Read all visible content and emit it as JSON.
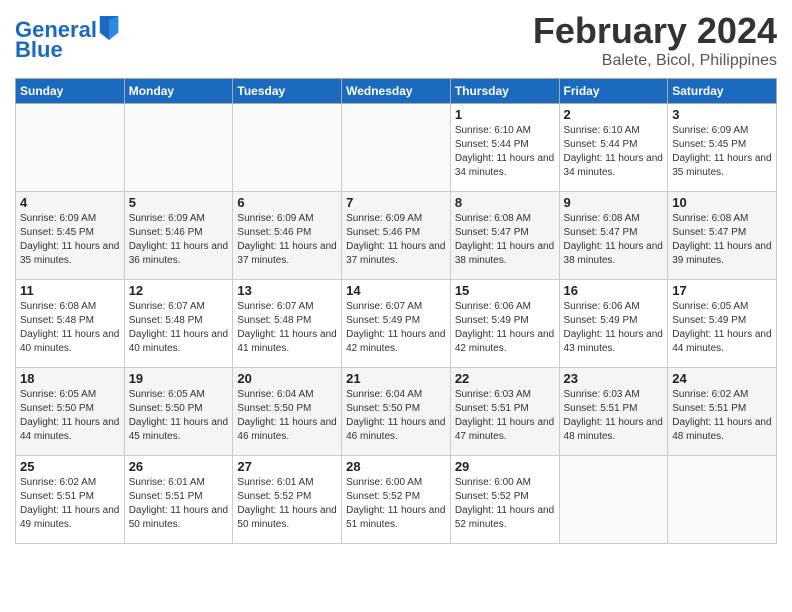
{
  "header": {
    "logo_line1": "General",
    "logo_line2": "Blue",
    "month": "February 2024",
    "location": "Balete, Bicol, Philippines"
  },
  "weekdays": [
    "Sunday",
    "Monday",
    "Tuesday",
    "Wednesday",
    "Thursday",
    "Friday",
    "Saturday"
  ],
  "weeks": [
    [
      {
        "day": "",
        "info": ""
      },
      {
        "day": "",
        "info": ""
      },
      {
        "day": "",
        "info": ""
      },
      {
        "day": "",
        "info": ""
      },
      {
        "day": "1",
        "info": "Sunrise: 6:10 AM\nSunset: 5:44 PM\nDaylight: 11 hours\nand 34 minutes."
      },
      {
        "day": "2",
        "info": "Sunrise: 6:10 AM\nSunset: 5:44 PM\nDaylight: 11 hours\nand 34 minutes."
      },
      {
        "day": "3",
        "info": "Sunrise: 6:09 AM\nSunset: 5:45 PM\nDaylight: 11 hours\nand 35 minutes."
      }
    ],
    [
      {
        "day": "4",
        "info": "Sunrise: 6:09 AM\nSunset: 5:45 PM\nDaylight: 11 hours\nand 35 minutes."
      },
      {
        "day": "5",
        "info": "Sunrise: 6:09 AM\nSunset: 5:46 PM\nDaylight: 11 hours\nand 36 minutes."
      },
      {
        "day": "6",
        "info": "Sunrise: 6:09 AM\nSunset: 5:46 PM\nDaylight: 11 hours\nand 37 minutes."
      },
      {
        "day": "7",
        "info": "Sunrise: 6:09 AM\nSunset: 5:46 PM\nDaylight: 11 hours\nand 37 minutes."
      },
      {
        "day": "8",
        "info": "Sunrise: 6:08 AM\nSunset: 5:47 PM\nDaylight: 11 hours\nand 38 minutes."
      },
      {
        "day": "9",
        "info": "Sunrise: 6:08 AM\nSunset: 5:47 PM\nDaylight: 11 hours\nand 38 minutes."
      },
      {
        "day": "10",
        "info": "Sunrise: 6:08 AM\nSunset: 5:47 PM\nDaylight: 11 hours\nand 39 minutes."
      }
    ],
    [
      {
        "day": "11",
        "info": "Sunrise: 6:08 AM\nSunset: 5:48 PM\nDaylight: 11 hours\nand 40 minutes."
      },
      {
        "day": "12",
        "info": "Sunrise: 6:07 AM\nSunset: 5:48 PM\nDaylight: 11 hours\nand 40 minutes."
      },
      {
        "day": "13",
        "info": "Sunrise: 6:07 AM\nSunset: 5:48 PM\nDaylight: 11 hours\nand 41 minutes."
      },
      {
        "day": "14",
        "info": "Sunrise: 6:07 AM\nSunset: 5:49 PM\nDaylight: 11 hours\nand 42 minutes."
      },
      {
        "day": "15",
        "info": "Sunrise: 6:06 AM\nSunset: 5:49 PM\nDaylight: 11 hours\nand 42 minutes."
      },
      {
        "day": "16",
        "info": "Sunrise: 6:06 AM\nSunset: 5:49 PM\nDaylight: 11 hours\nand 43 minutes."
      },
      {
        "day": "17",
        "info": "Sunrise: 6:05 AM\nSunset: 5:49 PM\nDaylight: 11 hours\nand 44 minutes."
      }
    ],
    [
      {
        "day": "18",
        "info": "Sunrise: 6:05 AM\nSunset: 5:50 PM\nDaylight: 11 hours\nand 44 minutes."
      },
      {
        "day": "19",
        "info": "Sunrise: 6:05 AM\nSunset: 5:50 PM\nDaylight: 11 hours\nand 45 minutes."
      },
      {
        "day": "20",
        "info": "Sunrise: 6:04 AM\nSunset: 5:50 PM\nDaylight: 11 hours\nand 46 minutes."
      },
      {
        "day": "21",
        "info": "Sunrise: 6:04 AM\nSunset: 5:50 PM\nDaylight: 11 hours\nand 46 minutes."
      },
      {
        "day": "22",
        "info": "Sunrise: 6:03 AM\nSunset: 5:51 PM\nDaylight: 11 hours\nand 47 minutes."
      },
      {
        "day": "23",
        "info": "Sunrise: 6:03 AM\nSunset: 5:51 PM\nDaylight: 11 hours\nand 48 minutes."
      },
      {
        "day": "24",
        "info": "Sunrise: 6:02 AM\nSunset: 5:51 PM\nDaylight: 11 hours\nand 48 minutes."
      }
    ],
    [
      {
        "day": "25",
        "info": "Sunrise: 6:02 AM\nSunset: 5:51 PM\nDaylight: 11 hours\nand 49 minutes."
      },
      {
        "day": "26",
        "info": "Sunrise: 6:01 AM\nSunset: 5:51 PM\nDaylight: 11 hours\nand 50 minutes."
      },
      {
        "day": "27",
        "info": "Sunrise: 6:01 AM\nSunset: 5:52 PM\nDaylight: 11 hours\nand 50 minutes."
      },
      {
        "day": "28",
        "info": "Sunrise: 6:00 AM\nSunset: 5:52 PM\nDaylight: 11 hours\nand 51 minutes."
      },
      {
        "day": "29",
        "info": "Sunrise: 6:00 AM\nSunset: 5:52 PM\nDaylight: 11 hours\nand 52 minutes."
      },
      {
        "day": "",
        "info": ""
      },
      {
        "day": "",
        "info": ""
      }
    ]
  ]
}
